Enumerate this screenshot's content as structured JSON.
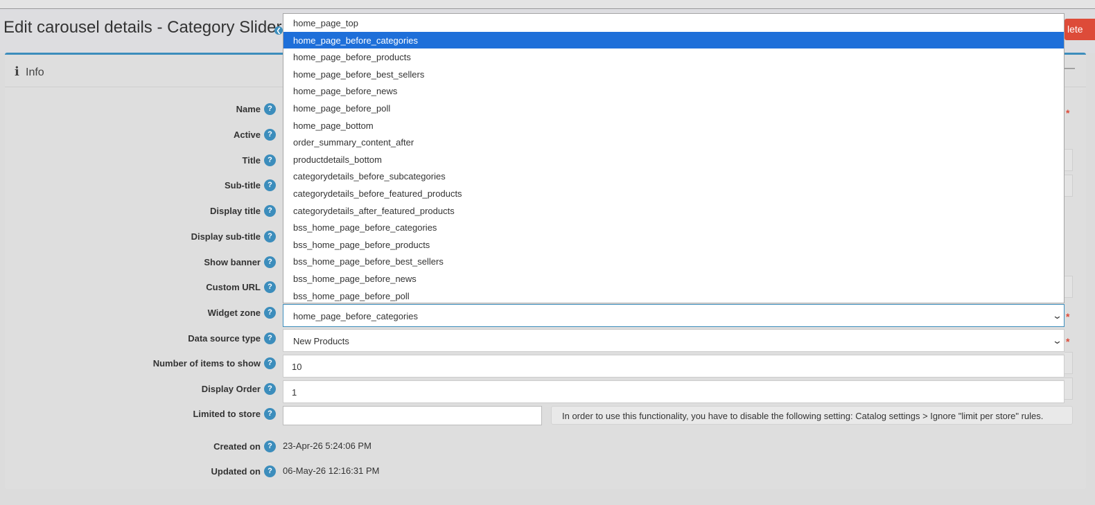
{
  "header": {
    "title": "Edit carousel details - Category Slider",
    "delete_label": "lete"
  },
  "card": {
    "title": "Info"
  },
  "labels": {
    "name": "Name",
    "active": "Active",
    "title": "Title",
    "subtitle": "Sub-title",
    "display_title": "Display title",
    "display_subtitle": "Display sub-title",
    "show_banner": "Show banner",
    "custom_url": "Custom URL",
    "widget_zone": "Widget zone",
    "data_source_type": "Data source type",
    "items_to_show": "Number of items to show",
    "display_order": "Display Order",
    "limited_to_store": "Limited to store",
    "created_on": "Created on",
    "updated_on": "Updated on"
  },
  "values": {
    "widget_zone": "home_page_before_categories",
    "data_source_type": "New Products",
    "items_to_show": "10",
    "display_order": "1",
    "created_on": "23-Apr-26 5:24:06 PM",
    "updated_on": "06-May-26 12:16:31 PM"
  },
  "store_note": "In order to use this functionality, you have to disable the following setting: Catalog settings > Ignore \"limit per store\" rules.",
  "dropdown": {
    "options": [
      "home_page_top",
      "home_page_before_categories",
      "home_page_before_products",
      "home_page_before_best_sellers",
      "home_page_before_news",
      "home_page_before_poll",
      "home_page_bottom",
      "order_summary_content_after",
      "productdetails_bottom",
      "categorydetails_before_subcategories",
      "categorydetails_before_featured_products",
      "categorydetails_after_featured_products",
      "bss_home_page_before_categories",
      "bss_home_page_before_products",
      "bss_home_page_before_best_sellers",
      "bss_home_page_before_news",
      "bss_home_page_before_poll"
    ],
    "selected_index": 1
  },
  "glyphs": {
    "help": "?",
    "required": "*",
    "chevron": "⌄",
    "info": "i",
    "collapse": "—",
    "back": "❮"
  },
  "colors": {
    "accent": "#3c8dbc",
    "selected_option": "#1e6fd9",
    "danger": "#dd4b39"
  }
}
